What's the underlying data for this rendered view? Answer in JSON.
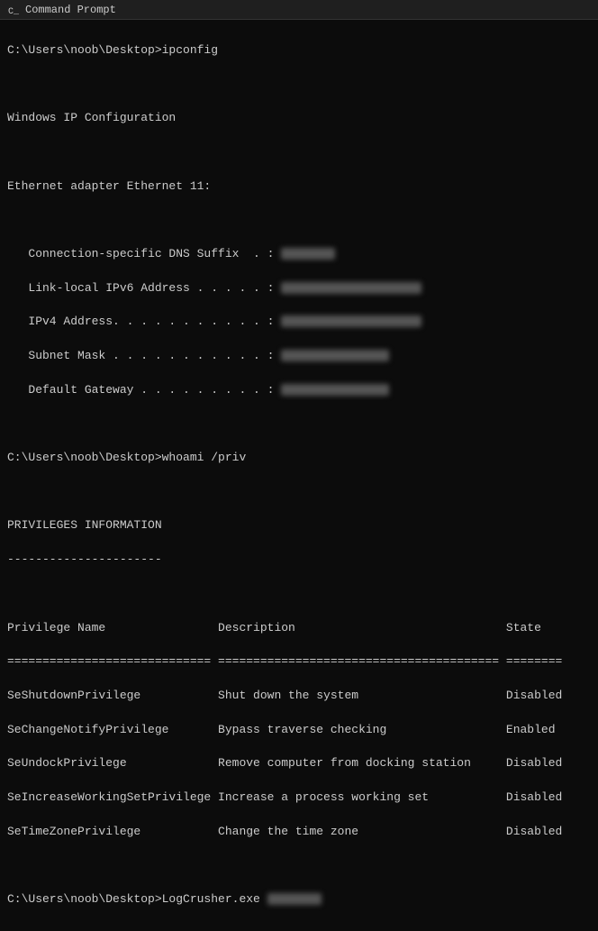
{
  "titleBar": {
    "icon": "cmd",
    "title": "Command Prompt"
  },
  "terminal": {
    "lines": [
      {
        "id": "cmd1",
        "text": "C:\\Users\\noob\\Desktop>ipconfig"
      },
      {
        "id": "blank1",
        "text": ""
      },
      {
        "id": "win-ip",
        "text": "Windows IP Configuration"
      },
      {
        "id": "blank2",
        "text": ""
      },
      {
        "id": "ethernet-header",
        "text": "Ethernet adapter Ethernet 11:"
      },
      {
        "id": "blank3",
        "text": ""
      },
      {
        "id": "dns",
        "text": "   Connection-specific DNS Suffix  . : ",
        "blurred": true,
        "blurSize": "small"
      },
      {
        "id": "ipv6",
        "text": "   Link-local IPv6 Address . . . . . : ",
        "blurred": true,
        "blurSize": "large"
      },
      {
        "id": "ipv4",
        "text": "   IPv4 Address. . . . . . . . . . . : ",
        "blurred": true,
        "blurSize": "large"
      },
      {
        "id": "subnet",
        "text": "   Subnet Mask . . . . . . . . . . . : ",
        "blurred": true,
        "blurSize": "medium"
      },
      {
        "id": "gateway",
        "text": "   Default Gateway . . . . . . . . . : ",
        "blurred": true,
        "blurSize": "medium"
      },
      {
        "id": "blank4",
        "text": ""
      },
      {
        "id": "cmd2",
        "text": "C:\\Users\\noob\\Desktop>whoami /priv"
      },
      {
        "id": "blank5",
        "text": ""
      },
      {
        "id": "priv-header",
        "text": "PRIVILEGES INFORMATION"
      },
      {
        "id": "priv-sep",
        "text": "----------------------"
      },
      {
        "id": "blank6",
        "text": ""
      },
      {
        "id": "col-header",
        "text": "Privilege Name                Description                              State   "
      },
      {
        "id": "col-sep",
        "text": "============================= ======================================== ========"
      },
      {
        "id": "priv1",
        "text": "SeShutdownPrivilege           Shut down the system                     Disabled"
      },
      {
        "id": "priv2",
        "text": "SeChangeNotifyPrivilege       Bypass traverse checking                 Enabled "
      },
      {
        "id": "priv3",
        "text": "SeUndockPrivilege             Remove computer from docking station     Disabled"
      },
      {
        "id": "priv4",
        "text": "SeIncreaseWorkingSetPrivilege Increase a process working set           Disabled"
      },
      {
        "id": "priv5",
        "text": "SeTimeZonePrivilege           Change the time zone                     Disabled"
      },
      {
        "id": "blank7",
        "text": ""
      },
      {
        "id": "cmd3",
        "text": "C:\\Users\\noob\\Desktop>LogCrusher.exe "
      }
    ]
  }
}
